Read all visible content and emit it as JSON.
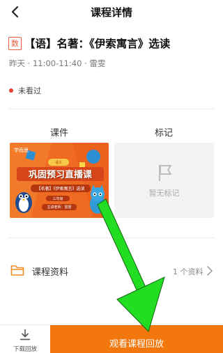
{
  "header": {
    "title": "课程详情"
  },
  "course": {
    "subject_badge": "数",
    "title": "【语】名著：《伊索寓言》选读",
    "meta": "昨天 · 11:00-11:40 · 雷雯",
    "status": "未看过"
  },
  "tabs": {
    "courseware": "课件",
    "marks": "标记"
  },
  "courseware_card": {
    "logo": "学而思",
    "tag": "语文",
    "title": "巩固预习直播课",
    "subtitle": "【名著】《伊索寓言》选读",
    "grade": "三年级",
    "teacher": "主讲老师：雷雯"
  },
  "marks_card": {
    "empty_text": "暂无标记"
  },
  "materials": {
    "label": "课程资料",
    "count": "1 个资料"
  },
  "bottom": {
    "download_label": "下载回放",
    "watch_label": "观看课程回放"
  },
  "colors": {
    "accent": "#f2770d",
    "status_dot": "#e8402c",
    "arrow": "#22dd22"
  }
}
